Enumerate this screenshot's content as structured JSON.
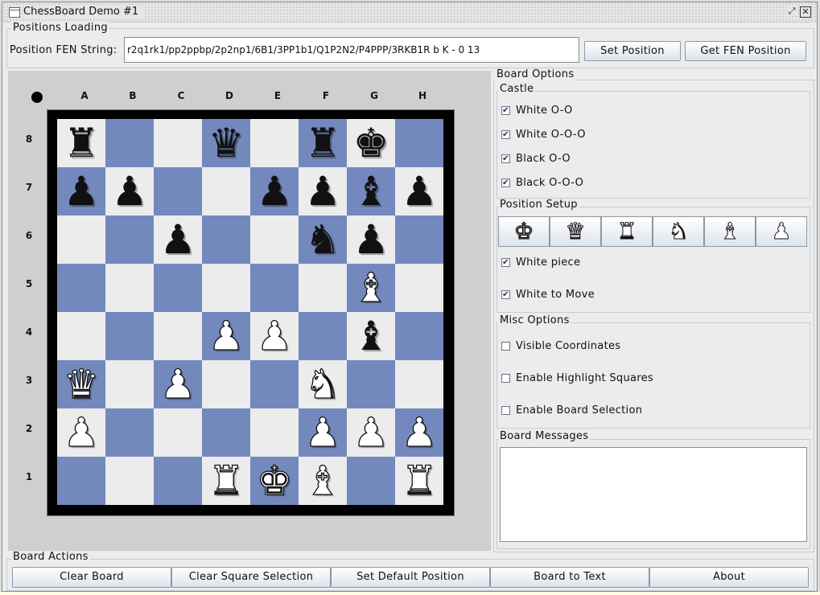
{
  "window": {
    "title": "ChessBoard Demo #1"
  },
  "positions_loading": {
    "group_title": "Positions Loading",
    "fen_label": "Position FEN String:",
    "fen_value": "r2q1rk1/pp2ppbp/2p2np1/6B1/3PP1b1/Q1P2N2/P4PPP/3RKB1R b K - 0 13",
    "set_position": "Set Position",
    "get_fen": "Get FEN Position"
  },
  "board": {
    "files": [
      "A",
      "B",
      "C",
      "D",
      "E",
      "F",
      "G",
      "H"
    ],
    "ranks": [
      "8",
      "7",
      "6",
      "5",
      "4",
      "3",
      "2",
      "1"
    ],
    "squares": [
      [
        "bR",
        "",
        "",
        "bQ",
        "",
        "bR",
        "bK",
        ""
      ],
      [
        "bP",
        "bP",
        "",
        "",
        "bP",
        "bP",
        "bB",
        "bP"
      ],
      [
        "",
        "",
        "bP",
        "",
        "",
        "bN",
        "bP",
        ""
      ],
      [
        "",
        "",
        "",
        "",
        "",
        "",
        "wB",
        ""
      ],
      [
        "",
        "",
        "",
        "wP",
        "wP",
        "",
        "bB",
        ""
      ],
      [
        "wQ",
        "",
        "wP",
        "",
        "",
        "wN",
        "",
        ""
      ],
      [
        "wP",
        "",
        "",
        "",
        "",
        "wP",
        "wP",
        "wP"
      ],
      [
        "",
        "",
        "",
        "wR",
        "wK",
        "wB",
        "",
        "wR"
      ]
    ],
    "glyphs": {
      "K": "♚",
      "Q": "♛",
      "R": "♜",
      "B": "♝",
      "N": "♞",
      "P": "♟"
    }
  },
  "board_options": {
    "group_title": "Board Options",
    "castle": {
      "title": "Castle",
      "items": [
        {
          "label": "White O-O",
          "checked": true
        },
        {
          "label": "White O-O-O",
          "checked": true
        },
        {
          "label": "Black O-O",
          "checked": true
        },
        {
          "label": "Black O-O-O",
          "checked": true
        }
      ]
    },
    "position_setup": {
      "title": "Position Setup",
      "pieces": [
        {
          "name": "king",
          "glyph": "♚"
        },
        {
          "name": "queen",
          "glyph": "♛"
        },
        {
          "name": "rook",
          "glyph": "♜"
        },
        {
          "name": "knight",
          "glyph": "♞"
        },
        {
          "name": "bishop",
          "glyph": "♝"
        },
        {
          "name": "pawn",
          "glyph": "♟"
        }
      ],
      "white_piece": {
        "label": "White piece",
        "checked": true
      },
      "white_to_move": {
        "label": "White to Move",
        "checked": true
      }
    },
    "misc": {
      "title": "Misc Options",
      "items": [
        {
          "label": "Visible Coordinates",
          "checked": false
        },
        {
          "label": "Enable Highlight Squares",
          "checked": false
        },
        {
          "label": "Enable Board Selection",
          "checked": false
        }
      ]
    },
    "messages": {
      "title": "Board Messages"
    }
  },
  "board_actions": {
    "group_title": "Board Actions",
    "buttons": [
      "Clear Board",
      "Clear Square Selection",
      "Set Default Position",
      "Board to Text",
      "About"
    ]
  },
  "colors": {
    "light_square": "#ececec",
    "dark_square": "#7389bd",
    "frame": "#000000"
  }
}
